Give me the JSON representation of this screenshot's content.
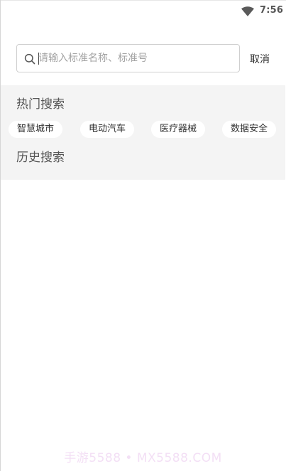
{
  "status_bar": {
    "time": "7:56",
    "wifi_icon": "wifi-icon"
  },
  "search": {
    "placeholder": "请输入标准名称、标准号",
    "value": "",
    "icon": "search-icon",
    "cancel_label": "取消"
  },
  "hot_search": {
    "title": "热门搜索",
    "items": [
      "智慧城市",
      "电动汽车",
      "医疗器械",
      "数据安全"
    ]
  },
  "history_search": {
    "title": "历史搜索",
    "items": []
  },
  "watermark": "手游5588 • MX5588.COM"
}
